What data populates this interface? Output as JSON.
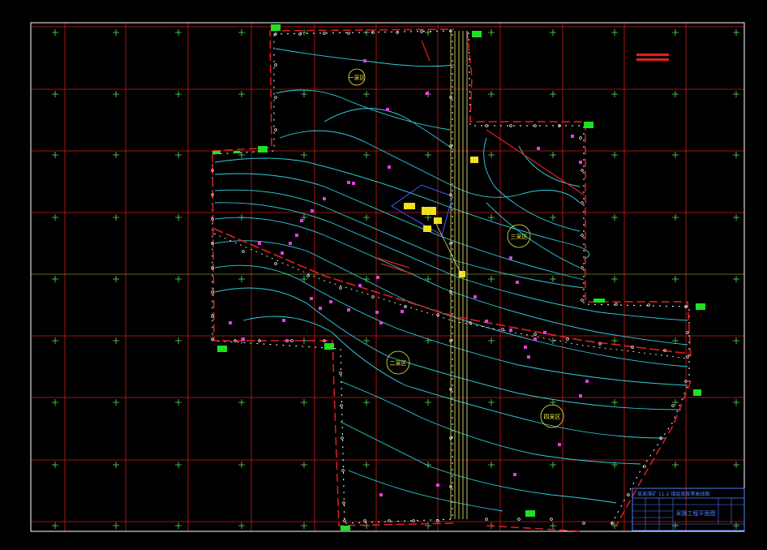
{
  "drawing": {
    "zone_labels": [
      {
        "id": "zone-1",
        "text": "一采区"
      },
      {
        "id": "zone-2",
        "text": "二采区"
      },
      {
        "id": "zone-3",
        "text": "三采区"
      },
      {
        "id": "zone-4",
        "text": "四采区"
      }
    ],
    "title_block": {
      "caption": "某某煤矿 11-2 煤层底板等高线图",
      "drawing_title": "采掘工程平面图"
    }
  },
  "colors": {
    "background": "#000000",
    "grid_lines": "#d01818",
    "grid_crosses": "#60e060",
    "border": "#ffffff",
    "contours": "#30d0e0",
    "boundary": "#ffffff",
    "boundary_red": "#e02020",
    "road_lines": "#f0f070",
    "markers": "#e040e0",
    "survey_points": "#ffffff",
    "green_blocks": "#20e020",
    "labels": "#f0f040",
    "title_block_lines": "#5080ff"
  }
}
